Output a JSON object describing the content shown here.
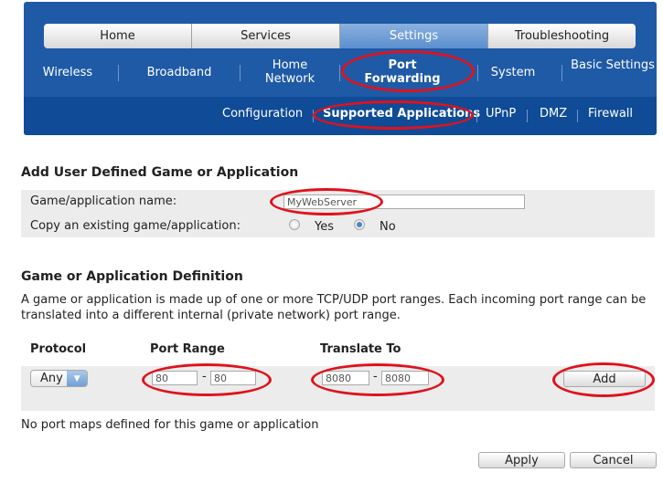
{
  "nav": {
    "tabs": [
      "Home",
      "Services",
      "Settings",
      "Troubleshooting"
    ],
    "active_tab": "Settings",
    "subnav": [
      "Wireless",
      "Broadband",
      "Home Network",
      "Port Forwarding",
      "System",
      "Basic Settings"
    ],
    "thirdnav": [
      "Configuration",
      "Supported Applications",
      "UPnP",
      "DMZ",
      "Firewall"
    ]
  },
  "add_section": {
    "heading": "Add User Defined Game or Application",
    "name_label": "Game/application name:",
    "name_value": "MyWebServer",
    "copy_label": "Copy an existing game/application:",
    "yes_label": "Yes",
    "no_label": "No",
    "copy_selected": "No"
  },
  "definition": {
    "heading": "Game or Application Definition",
    "description": "A game or application is made up of one or more TCP/UDP port ranges. Each incoming port range can be translated into a different internal (private network) port range.",
    "col_protocol": "Protocol",
    "col_port_range": "Port Range",
    "col_translate": "Translate To",
    "protocol_value": "Any",
    "port_from": "80",
    "port_to": "80",
    "translate_from": "8080",
    "translate_to": "8080",
    "range_separator": "-",
    "add_label": "Add",
    "empty_message": "No port maps defined for this game or application"
  },
  "actions": {
    "apply_label": "Apply",
    "cancel_label": "Cancel"
  },
  "colors": {
    "header_blue": "#1f5aa6",
    "header_dark": "#0f4b97",
    "highlight_red": "#e0121c"
  }
}
